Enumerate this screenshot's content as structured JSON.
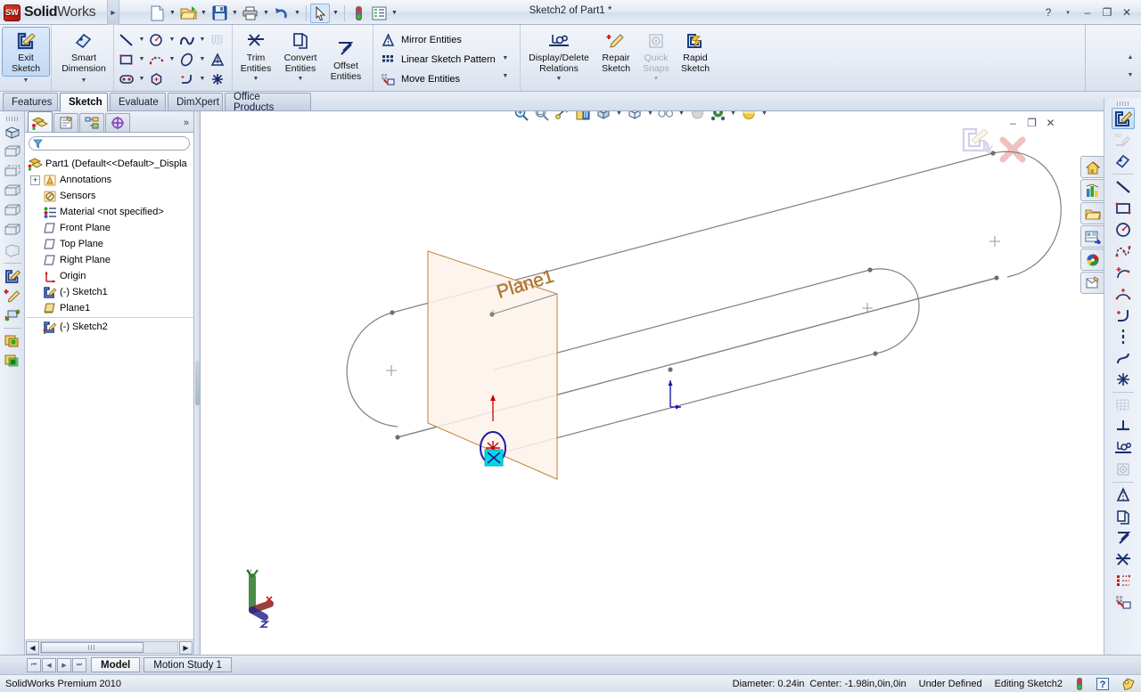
{
  "app": {
    "brand_bold": "Solid",
    "brand_light": "Works",
    "logo_text": "SW",
    "title": "Sketch2 of Part1 *",
    "version_status": "SolidWorks Premium 2010"
  },
  "quick_access": [
    {
      "name": "new-document",
      "icon": "new-doc-icon",
      "has_dropdown": true
    },
    {
      "name": "open-document",
      "icon": "open-folder-icon",
      "has_dropdown": true
    },
    {
      "name": "save-document",
      "icon": "save-disk-icon",
      "has_dropdown": true
    },
    {
      "name": "print-document",
      "icon": "printer-icon",
      "has_dropdown": true
    },
    {
      "name": "undo",
      "icon": "undo-arrow-icon",
      "has_dropdown": true
    },
    {
      "name": "select",
      "icon": "select-cursor-icon",
      "has_dropdown": true
    },
    {
      "name": "rebuild",
      "icon": "traffic-light-icon",
      "has_dropdown": false
    },
    {
      "name": "options",
      "icon": "options-list-icon",
      "has_dropdown": true
    }
  ],
  "titlebar_controls": [
    {
      "name": "help",
      "glyph": "?"
    },
    {
      "name": "help-dropdown",
      "glyph": "▾"
    },
    {
      "name": "minimize",
      "glyph": "–"
    },
    {
      "name": "restore",
      "glyph": "❐"
    },
    {
      "name": "close",
      "glyph": "✕"
    }
  ],
  "ribbon": {
    "groups": [
      {
        "name": "exit-sketch",
        "buttons": [
          {
            "label_line1": "Exit",
            "label_line2": "Sketch",
            "icon": "exit-sketch-icon",
            "active": true,
            "dropdown": true
          }
        ]
      },
      {
        "name": "smart-dimension",
        "buttons": [
          {
            "label_line1": "Smart",
            "label_line2": "Dimension",
            "icon": "smart-dimension-icon",
            "active": false,
            "dropdown": true
          }
        ]
      },
      {
        "name": "sketch-entities",
        "tools": [
          {
            "icon": "line-icon",
            "dropdown": true
          },
          {
            "icon": "circle-icon",
            "dropdown": true
          },
          {
            "icon": "spline-icon",
            "dropdown": true
          },
          {
            "icon": "sketch-pattern-faded-icon",
            "dropdown": false,
            "disabled": true
          },
          {
            "icon": "rectangle-icon",
            "dropdown": true
          },
          {
            "icon": "arc-3point-icon",
            "dropdown": true
          },
          {
            "icon": "ellipse-icon",
            "dropdown": true
          },
          {
            "icon": "text-icon",
            "dropdown": false
          },
          {
            "icon": "slot-icon",
            "dropdown": true
          },
          {
            "icon": "polygon-icon",
            "dropdown": false
          },
          {
            "icon": "fillet-icon",
            "dropdown": true
          },
          {
            "icon": "point-icon",
            "dropdown": false
          }
        ]
      },
      {
        "name": "trim-convert",
        "buttons": [
          {
            "label_line1": "Trim",
            "label_line2": "Entities",
            "icon": "trim-entities-icon",
            "dropdown": true
          },
          {
            "label_line1": "Convert",
            "label_line2": "Entities",
            "icon": "convert-entities-icon",
            "dropdown": true
          },
          {
            "label_line1": "Offset",
            "label_line2": "Entities",
            "icon": "offset-entities-icon",
            "dropdown": false
          }
        ]
      },
      {
        "name": "sketch-tools",
        "rows": [
          {
            "label": "Mirror Entities",
            "icon": "mirror-entities-icon",
            "dropdown": false
          },
          {
            "label": "Linear Sketch Pattern",
            "icon": "linear-sketch-pattern-icon",
            "dropdown": true
          },
          {
            "label": "Move Entities",
            "icon": "move-entities-icon",
            "dropdown": true
          }
        ]
      },
      {
        "name": "relations",
        "buttons": [
          {
            "label_line1": "Display/Delete",
            "label_line2": "Relations",
            "icon": "display-delete-relations-icon",
            "dropdown": true
          },
          {
            "label_line1": "Repair",
            "label_line2": "Sketch",
            "icon": "repair-sketch-icon",
            "dropdown": false
          },
          {
            "label_line1": "Quick",
            "label_line2": "Snaps",
            "icon": "quick-snaps-icon",
            "dropdown": true,
            "disabled": true
          },
          {
            "label_line1": "Rapid",
            "label_line2": "Sketch",
            "icon": "rapid-sketch-icon",
            "dropdown": false
          }
        ]
      }
    ]
  },
  "command_tabs": [
    {
      "label": "Features",
      "selected": false
    },
    {
      "label": "Sketch",
      "selected": true
    },
    {
      "label": "Evaluate",
      "selected": false
    },
    {
      "label": "DimXpert",
      "selected": false
    },
    {
      "label": "Office Products",
      "selected": false
    }
  ],
  "left_toolbar": [
    {
      "name": "isometric-view",
      "icon": "isometric-view-icon"
    },
    {
      "name": "wireframe-view",
      "icon": "wireframe-icon"
    },
    {
      "name": "hidden-lines-visible",
      "icon": "hidden-lines-visible-icon"
    },
    {
      "name": "hidden-lines-removed",
      "icon": "hidden-lines-removed-icon"
    },
    {
      "name": "shaded",
      "icon": "shaded-icon"
    },
    {
      "name": "shaded-with-edges",
      "icon": "shaded-edges-icon"
    },
    {
      "name": "draft-quality",
      "icon": "draft-quality-icon"
    },
    {
      "name": "sketch-tool",
      "icon": "sketch-pencil-icon"
    },
    {
      "name": "repair-sketch-tool",
      "icon": "repair-pencil-icon"
    },
    {
      "name": "3d-sketch-plane",
      "icon": "sketch-plane-icon"
    },
    {
      "name": "section-view",
      "icon": "section-view-icon"
    },
    {
      "name": "section-view-2",
      "icon": "section-view-2-icon"
    }
  ],
  "feature_tree": {
    "tabs": [
      {
        "name": "feature-manager",
        "icon": "feature-manager-icon",
        "selected": true
      },
      {
        "name": "property-manager",
        "icon": "property-manager-icon",
        "selected": false
      },
      {
        "name": "configuration-manager",
        "icon": "configuration-manager-icon",
        "selected": false
      },
      {
        "name": "dimxpert-manager",
        "icon": "dimxpert-manager-icon",
        "selected": false
      }
    ],
    "more_glyph": "»",
    "filter_placeholder": "",
    "nodes": [
      {
        "label": "Part1  (Default<<Default>_Displa",
        "icon": "part-icon",
        "expander": "none",
        "indent": 0,
        "root": true
      },
      {
        "label": "Annotations",
        "icon": "annotations-icon",
        "expander": "+",
        "indent": 1
      },
      {
        "label": "Sensors",
        "icon": "sensors-icon",
        "expander": "none",
        "indent": 1
      },
      {
        "label": "Material <not specified>",
        "icon": "material-icon",
        "expander": "none",
        "indent": 1
      },
      {
        "label": "Front Plane",
        "icon": "plane-icon",
        "expander": "none",
        "indent": 1
      },
      {
        "label": "Top Plane",
        "icon": "plane-icon",
        "expander": "none",
        "indent": 1
      },
      {
        "label": "Right Plane",
        "icon": "plane-icon",
        "expander": "none",
        "indent": 1
      },
      {
        "label": "Origin",
        "icon": "origin-icon",
        "expander": "none",
        "indent": 1
      },
      {
        "label": "(-) Sketch1",
        "icon": "sketch-icon",
        "expander": "none",
        "indent": 1
      },
      {
        "label": "Plane1",
        "icon": "plane-yellow-icon",
        "expander": "none",
        "indent": 1
      },
      {
        "label": "(-) Sketch2",
        "icon": "sketch-active-icon",
        "expander": "none",
        "indent": 1,
        "separator_above": true
      }
    ]
  },
  "view_hud": [
    {
      "name": "zoom-to-fit",
      "icon": "zoom-fit-icon",
      "dropdown": false
    },
    {
      "name": "zoom-to-area",
      "icon": "zoom-area-icon",
      "dropdown": false
    },
    {
      "name": "previous-view",
      "icon": "previous-view-icon",
      "dropdown": false
    },
    {
      "name": "section-view",
      "icon": "section-view-hud-icon",
      "dropdown": false
    },
    {
      "name": "view-orientation",
      "icon": "view-orientation-icon",
      "dropdown": true
    },
    {
      "name": "display-style",
      "icon": "display-style-icon",
      "dropdown": true
    },
    {
      "name": "hide-show-items",
      "icon": "hide-show-items-icon",
      "dropdown": true
    },
    {
      "name": "apply-scene",
      "icon": "apply-scene-icon",
      "dropdown": false
    },
    {
      "name": "view-settings",
      "icon": "view-settings-icon",
      "dropdown": true
    },
    {
      "name": "real-view-graphics",
      "icon": "realview-icon",
      "dropdown": true
    }
  ],
  "graphics_window_controls": [
    {
      "name": "minimize-document",
      "glyph": "–"
    },
    {
      "name": "restore-document",
      "glyph": "❐"
    },
    {
      "name": "close-document",
      "glyph": "✕"
    }
  ],
  "sketch_confirmation": {
    "exit_sketch_name": "confirm-exit-sketch-icon",
    "cancel_name": "cancel-sketch-icon"
  },
  "task_pane": [
    {
      "name": "solidworks-resources",
      "icon": "home-icon"
    },
    {
      "name": "design-library",
      "icon": "design-library-icon"
    },
    {
      "name": "file-explorer",
      "icon": "folder-icon"
    },
    {
      "name": "search",
      "icon": "search-panel-icon"
    },
    {
      "name": "view-palette",
      "icon": "view-palette-icon"
    },
    {
      "name": "appearances-scenes",
      "icon": "appearances-icon"
    },
    {
      "name": "custom-properties",
      "icon": "custom-properties-icon"
    }
  ],
  "right_toolbar": [
    {
      "name": "sketch-tool",
      "icon": "sketch-pencil-icon",
      "active": true
    },
    {
      "name": "3d-sketch",
      "icon": "3d-sketch-icon",
      "disabled": true
    },
    {
      "name": "smart-dimension",
      "icon": "smart-dimension-icon",
      "sep_after": true
    },
    {
      "name": "line",
      "icon": "line-icon"
    },
    {
      "name": "rectangle",
      "icon": "rectangle-icon"
    },
    {
      "name": "circle",
      "icon": "circle-icon"
    },
    {
      "name": "spline",
      "icon": "spline-icon"
    },
    {
      "name": "arc-centerpoint",
      "icon": "arc-centerpoint-icon"
    },
    {
      "name": "arc-3point",
      "icon": "arc-3point-icon"
    },
    {
      "name": "fillet",
      "icon": "fillet-icon"
    },
    {
      "name": "centerline",
      "icon": "centerline-icon"
    },
    {
      "name": "spline-curve",
      "icon": "spline-curve-icon"
    },
    {
      "name": "point",
      "icon": "point-icon",
      "sep_after": true
    },
    {
      "name": "sketch-pattern",
      "icon": "sketch-pattern-faded-icon",
      "disabled": true
    },
    {
      "name": "add-relation",
      "icon": "add-relation-icon"
    },
    {
      "name": "display-delete-relations",
      "icon": "display-delete-relations-icon"
    },
    {
      "name": "quick-snaps",
      "icon": "quick-snaps-icon",
      "disabled": true,
      "sep_after": true
    },
    {
      "name": "mirror-entities",
      "icon": "mirror-entities-icon"
    },
    {
      "name": "convert-entities",
      "icon": "convert-entities-icon"
    },
    {
      "name": "offset-entities",
      "icon": "offset-entities-icon"
    },
    {
      "name": "trim-entities",
      "icon": "trim-entities-icon"
    },
    {
      "name": "linear-sketch-pattern",
      "icon": "linear-sketch-pattern-icon"
    },
    {
      "name": "move-entities",
      "icon": "move-entities-icon"
    }
  ],
  "model": {
    "plane_label": "Plane1",
    "plane_fill": "#fdf3ea",
    "plane_border": "#c08a4a",
    "edge_color": "#808080",
    "sketch_circle_color": "#1a1aa8",
    "origin_color": "#cc0000",
    "triad_name": "coordinate-triad"
  },
  "bottom_tabs": {
    "nav": [
      "⏮",
      "◀",
      "▶",
      "⏭"
    ],
    "tabs": [
      {
        "label": "Model",
        "selected": true
      },
      {
        "label": "Motion Study 1",
        "selected": false
      }
    ]
  },
  "status_bar": {
    "left_text": "SolidWorks Premium 2010",
    "diameter": "Diameter: 0.24in",
    "center": "Center: -1.98in,0in,0in",
    "state": "Under Defined",
    "editing": "Editing Sketch2",
    "rebuild_icon": "traffic-light-icon",
    "help_icon": "question-mark-icon",
    "tag_icon": "tag-icon"
  },
  "colors": {
    "accent_blue": "#1a1aa8",
    "plane_orange": "#c08a4a",
    "selection_cyan": "#00d0e0",
    "edge_gray": "#808080",
    "chrome_base": "#d6dce8"
  }
}
